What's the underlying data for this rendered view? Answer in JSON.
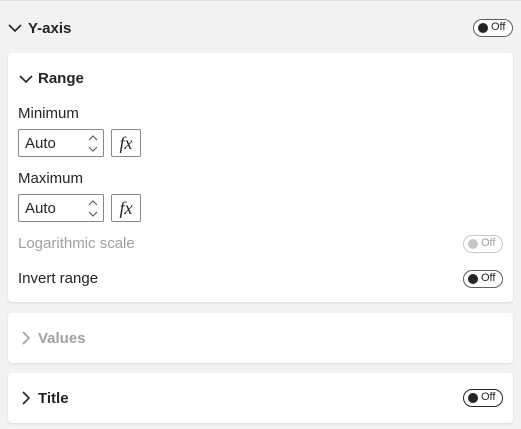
{
  "yaxis": {
    "title": "Y-axis",
    "toggle": "Off"
  },
  "range": {
    "title": "Range",
    "minimum": {
      "label": "Minimum",
      "value": "Auto",
      "fx": "fx"
    },
    "maximum": {
      "label": "Maximum",
      "value": "Auto",
      "fx": "fx"
    },
    "log_scale": {
      "label": "Logarithmic scale",
      "toggle": "Off"
    },
    "invert": {
      "label": "Invert range",
      "toggle": "Off"
    }
  },
  "values": {
    "title": "Values"
  },
  "title_section": {
    "title": "Title",
    "toggle": "Off"
  }
}
